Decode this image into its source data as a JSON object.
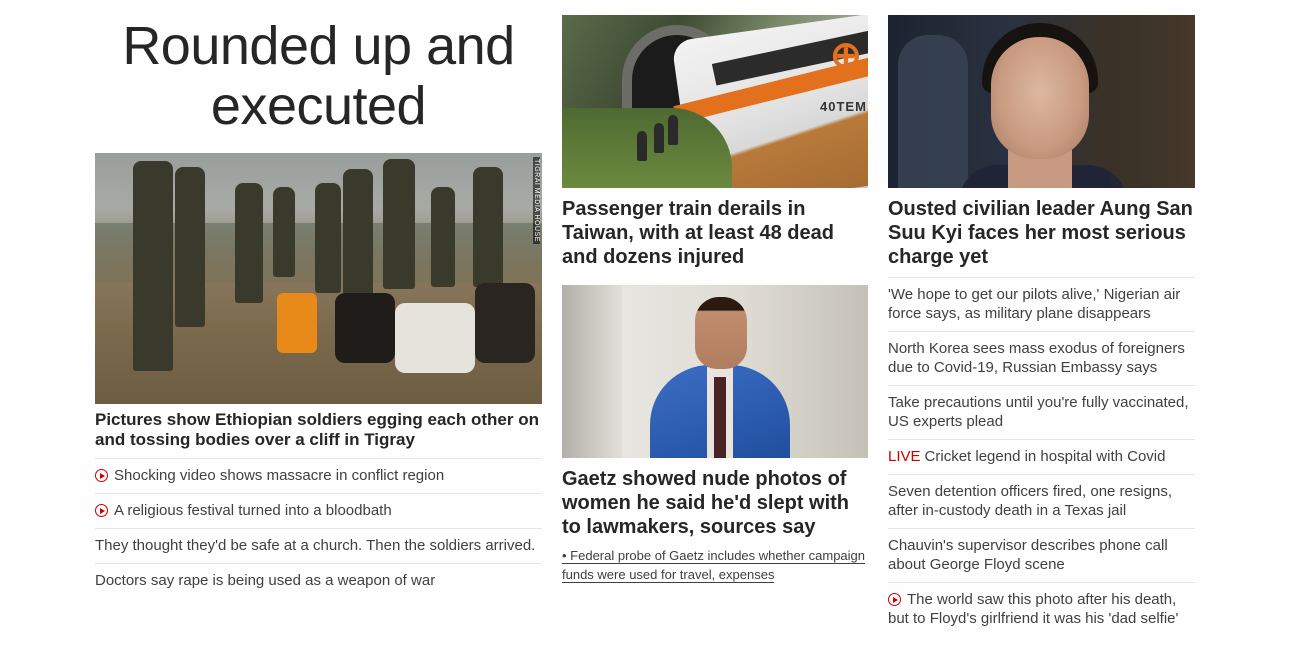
{
  "left": {
    "main_headline_line1": "Rounded up and",
    "main_headline_line2": "executed",
    "image_credit": "TIGRAI MEDIA HOUSE",
    "lead_caption": "Pictures show Ethiopian soldiers egging each other on and tossing bodies over a cliff in Tigray",
    "links": [
      {
        "text": "Shocking video shows massacre in conflict region",
        "video": true
      },
      {
        "text": "A religious festival turned into a bloodbath",
        "video": true
      },
      {
        "text": "They thought they'd be safe at a church. Then the soldiers arrived.",
        "video": false
      },
      {
        "text": "Doctors say rape is being used as a weapon of war",
        "video": false
      }
    ]
  },
  "middle": {
    "train_number": "40TEM",
    "story1_title": "Passenger train derails in Taiwan, with at least 48 dead and dozens injured",
    "story2_title": "Gaetz showed nude photos of women he said he'd slept with to lawmakers, sources say",
    "story2_sub": "• Federal probe of Gaetz includes whether campaign funds were used for travel, expenses"
  },
  "right": {
    "story_title": "Ousted civilian leader Aung San Suu Kyi faces her most serious charge yet",
    "live_label": "LIVE",
    "links": [
      {
        "text": "'We hope to get our pilots alive,' Nigerian air force says, as military plane disappears"
      },
      {
        "text": "North Korea sees mass exodus of foreigners due to Covid-19, Russian Embassy says"
      },
      {
        "text": "Take precautions until you're fully vaccinated, US experts plead"
      },
      {
        "text": "Cricket legend in hospital with Covid"
      },
      {
        "text": "Seven detention officers fired, one resigns, after in-custody death in a Texas jail"
      },
      {
        "text": "Chauvin's supervisor describes phone call about George Floyd scene"
      },
      {
        "text": "The world saw this photo after his death, but to Floyd's girlfriend it was his 'dad selfie'"
      }
    ]
  },
  "colors": {
    "text": "#262626",
    "link": "#404040",
    "accent_red": "#cc0000",
    "divider": "#e6e6e6"
  }
}
